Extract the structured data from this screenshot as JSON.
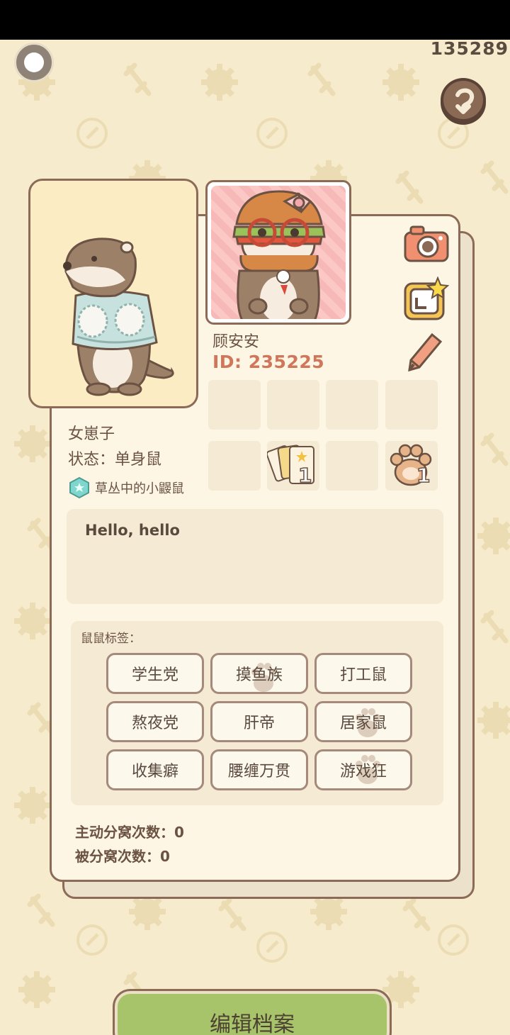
{
  "top_counter": "135289",
  "profile": {
    "nickname": "顾安安",
    "id_label": "ID: 235225",
    "gender": "女崽子",
    "status_label": "状态：",
    "status_value": "单身鼠",
    "title": "草丛中的小鼹鼠",
    "bio": "Hello, hello"
  },
  "badges": {
    "cards_count": "1",
    "paw_count": "1"
  },
  "tags": {
    "heading": "鼠鼠标签：",
    "items": [
      "学生党",
      "摸鱼族",
      "打工鼠",
      "熬夜党",
      "肝帝",
      "居家鼠",
      "收集癖",
      "腰缠万贯",
      "游戏狂"
    ]
  },
  "stats": {
    "active_split": "主动分窝次数：0",
    "passive_split": "被分窝次数：0"
  },
  "edit_button_label": "编辑档案",
  "colors": {
    "background": "#f6ebcd",
    "card": "#fdf6e4",
    "border": "#8b6b58",
    "id_accent": "#d0765a",
    "edit_button": "#a8c46a"
  },
  "icons": [
    "record-toggle-icon",
    "back-arrow-icon",
    "camera-icon",
    "album-star-icon",
    "pencil-icon",
    "cards-icon",
    "paw-icon",
    "star-badge-icon"
  ]
}
